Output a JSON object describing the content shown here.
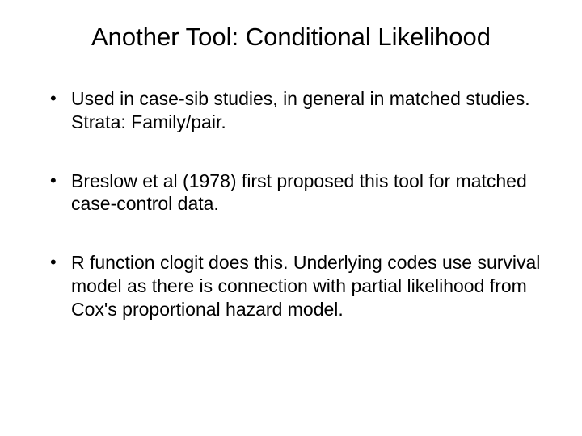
{
  "slide": {
    "title": "Another Tool: Conditional Likelihood",
    "bullets": [
      "Used in case-sib studies, in general in matched studies. Strata: Family/pair.",
      "Breslow et al (1978) first proposed this tool for matched case-control data.",
      "R function clogit does this. Underlying codes use survival model as there is connection with partial likelihood from Cox's proportional hazard model."
    ]
  }
}
